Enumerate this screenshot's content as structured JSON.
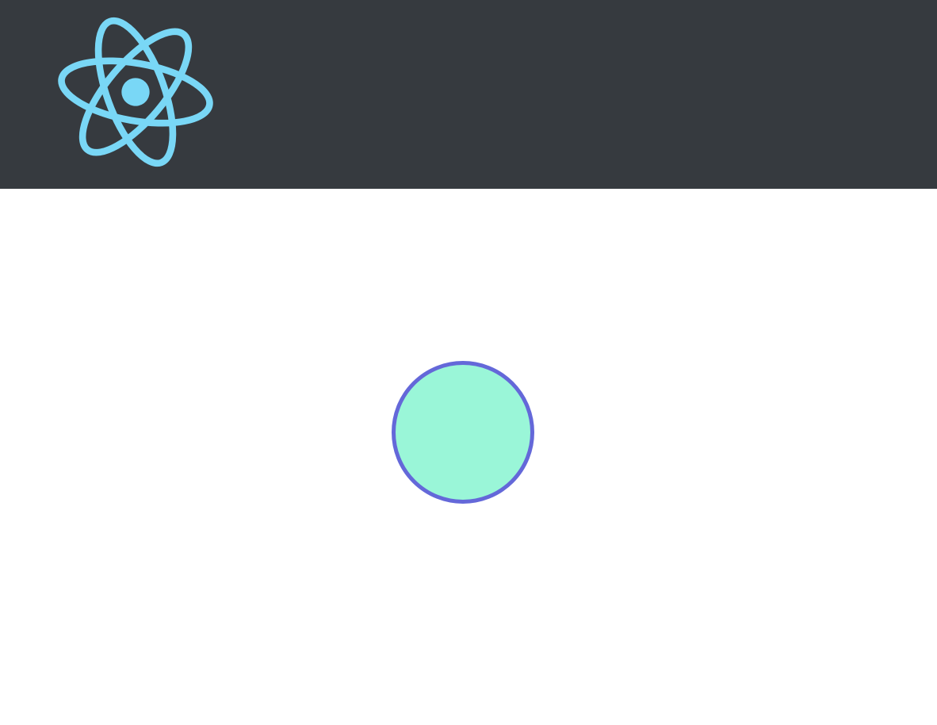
{
  "header": {
    "logo_icon": "react-atom-icon",
    "background_color": "#363a3f",
    "logo_color": "#79d7f6"
  },
  "main": {
    "circle": {
      "icon": "circle-shape",
      "fill_color": "#9af6d8",
      "border_color": "#6468d9"
    }
  }
}
